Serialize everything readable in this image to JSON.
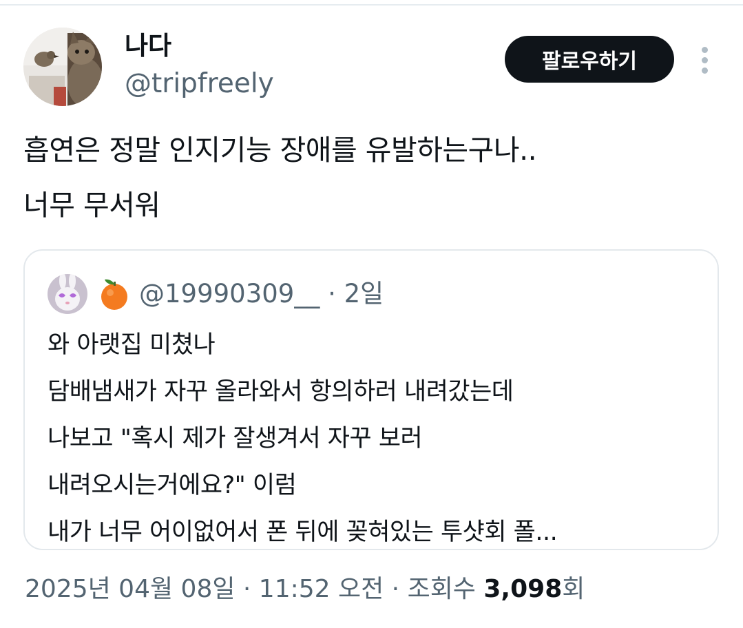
{
  "author": {
    "display_name": "나다",
    "handle": "@tripfreely"
  },
  "follow_button": {
    "label": "팔로우하기"
  },
  "tweet": {
    "lines": [
      "흡연은 정말 인지기능 장애를 유발하는구나..",
      "너무 무서워"
    ]
  },
  "quoted_tweet": {
    "handle_line": "@19990309__ · 2일",
    "lines": [
      "와 아랫집 미쳤나",
      "담배냄새가 자꾸 올라와서 항의하러 내려갔는데",
      "나보고 \"혹시 제가 잘생겨서 자꾸 보러",
      "내려오시는거에요?\" 이럼",
      "내가 너무 어이없어서 폰 뒤에 꽂혀있는 투샷회 폴..."
    ]
  },
  "meta": {
    "timestamp": "2025년 04월 08일 · 11:52 오전 · 조회수 ",
    "views_count": "3,098",
    "views_suffix": "회"
  },
  "icons": {
    "more": "more-vertical-icon",
    "quote_emoji": "tangerine-icon"
  },
  "colors": {
    "text": "#0f1419",
    "secondary": "#536471",
    "border": "#e3e8ec",
    "button_bg": "#0f1419",
    "button_text": "#ffffff"
  }
}
